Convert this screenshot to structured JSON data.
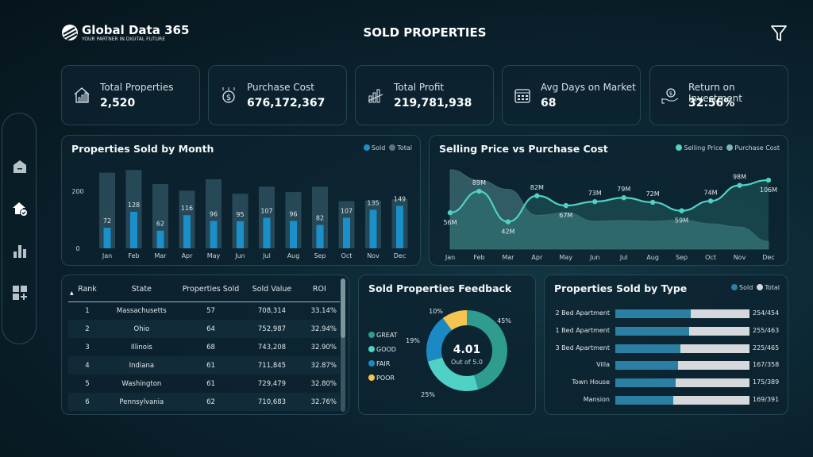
{
  "header": {
    "brand": "Global Data 365",
    "tagline": "YOUR PARTNER IN DIGITAL FUTURE",
    "title": "SOLD PROPERTIES",
    "filter_icon": "filter-icon"
  },
  "sidebar": {
    "items": [
      {
        "icon": "home-icon"
      },
      {
        "icon": "home-check-icon",
        "active": true
      },
      {
        "icon": "bar-chart-icon"
      },
      {
        "icon": "add-widget-icon"
      }
    ]
  },
  "kpis": [
    {
      "label": "Total Properties",
      "value": "2,520",
      "icon": "house-chart-icon"
    },
    {
      "label": "Purchase Cost",
      "value": "676,172,367",
      "icon": "dollar-coin-icon"
    },
    {
      "label": "Total Profit",
      "value": "219,781,938",
      "icon": "growth-chart-icon"
    },
    {
      "label": "Avg Days on Market",
      "value": "68",
      "icon": "calendar-icon"
    },
    {
      "label": "Return on Investment",
      "value": "32.56%",
      "icon": "hand-dollar-icon"
    }
  ],
  "colors": {
    "sold": "#1a8fc9",
    "total": "#2c4f5e",
    "selling": "#4fd1c5",
    "purchase": "#7fb3b8",
    "great": "#2e9c8f",
    "good": "#4fd1c5",
    "fair": "#1b8ac4",
    "poor": "#f5c451",
    "type_sold": "#2b7fa3",
    "type_total": "#d6d9db"
  },
  "chart_data": [
    {
      "type": "bar",
      "title": "Properties Sold by Month",
      "legend": [
        "Sold",
        "Total"
      ],
      "legend_position": "top-right",
      "categories": [
        "Jan",
        "Feb",
        "Mar",
        "Apr",
        "May",
        "Jun",
        "Jul",
        "Aug",
        "Sep",
        "Oct",
        "Nov",
        "Dec"
      ],
      "yticks": [
        "0",
        "200"
      ],
      "ylim": [
        0,
        280
      ],
      "series": [
        {
          "name": "Sold",
          "values": [
            72,
            128,
            62,
            116,
            96,
            95,
            107,
            96,
            82,
            107,
            135,
            149
          ]
        },
        {
          "name": "Total",
          "values": [
            265,
            274,
            225,
            202,
            242,
            191,
            216,
            197,
            216,
            165,
            167,
            172
          ]
        }
      ]
    },
    {
      "type": "area",
      "title": "Selling Price vs Purchase Cost",
      "legend": [
        "Selling Price",
        "Purchase Cost"
      ],
      "legend_position": "top-right",
      "categories": [
        "Jan",
        "Feb",
        "Mar",
        "Apr",
        "May",
        "Jun",
        "Jul",
        "Aug",
        "Sep",
        "Oct",
        "Nov",
        "Dec"
      ],
      "series": [
        {
          "name": "Selling Price",
          "values": [
            56,
            89,
            42,
            82,
            67,
            73,
            79,
            72,
            59,
            74,
            98,
            106
          ],
          "labels": [
            "56M",
            "89M",
            "42M",
            "82M",
            "67M",
            "73M",
            "79M",
            "72M",
            "59M",
            "74M",
            "98M",
            "106M"
          ]
        },
        {
          "name": "Purchase Cost",
          "values": [
            122,
            106,
            92,
            52,
            56,
            43,
            44,
            43,
            45,
            39,
            34,
            12
          ]
        }
      ]
    },
    {
      "type": "pie",
      "title": "Sold Properties Feedback",
      "center_value": "4.01",
      "center_label": "Out of 5.0",
      "categories": [
        "GREAT",
        "GOOD",
        "FAIR",
        "POOR"
      ],
      "values": [
        45,
        25,
        19,
        10
      ],
      "labels": [
        "45%",
        "25%",
        "19%",
        "10%"
      ]
    }
  ],
  "table": {
    "columns": [
      "Rank",
      "State",
      "Properties Sold",
      "Sold Value",
      "ROI"
    ],
    "sort": "Rank ascending",
    "rows": [
      [
        "1",
        "Massachusetts",
        "57",
        "708,314",
        "33.14%"
      ],
      [
        "2",
        "Ohio",
        "64",
        "752,987",
        "32.94%"
      ],
      [
        "3",
        "Illinois",
        "68",
        "743,208",
        "32.90%"
      ],
      [
        "4",
        "Indiana",
        "61",
        "711,845",
        "32.87%"
      ],
      [
        "5",
        "Washington",
        "61",
        "729,479",
        "32.80%"
      ],
      [
        "6",
        "Pennsylvania",
        "62",
        "710,683",
        "32.76%"
      ]
    ]
  },
  "types": {
    "title": "Properties Sold by Type",
    "legend": [
      "Sold",
      "Total"
    ],
    "rows": [
      {
        "label": "2 Bed Apartment",
        "sold": 254,
        "total": 454,
        "text": "254/454"
      },
      {
        "label": "1 Bed Apartment",
        "sold": 255,
        "total": 463,
        "text": "255/463"
      },
      {
        "label": "3 Bed Apartment",
        "sold": 225,
        "total": 465,
        "text": "225/465"
      },
      {
        "label": "Villa",
        "sold": 167,
        "total": 358,
        "text": "167/358"
      },
      {
        "label": "Town House",
        "sold": 175,
        "total": 389,
        "text": "175/389"
      },
      {
        "label": "Mansion",
        "sold": 169,
        "total": 391,
        "text": "169/391"
      }
    ]
  }
}
